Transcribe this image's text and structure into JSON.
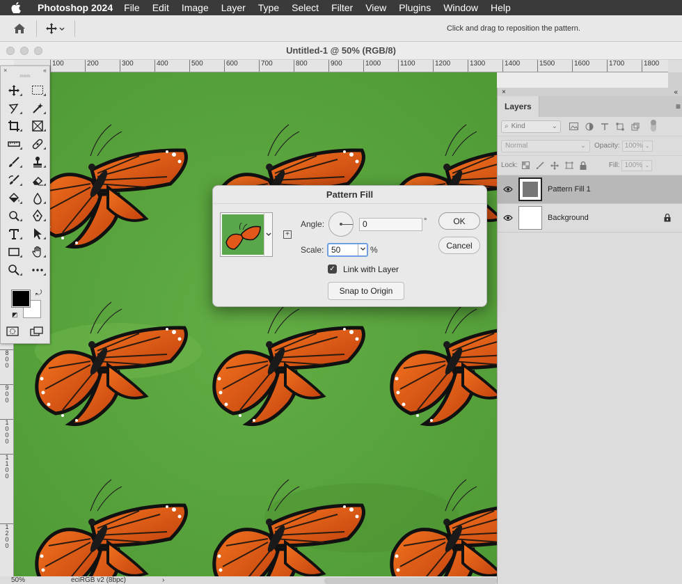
{
  "menubar": {
    "app_name": "Photoshop 2024",
    "menus": [
      "File",
      "Edit",
      "Image",
      "Layer",
      "Type",
      "Select",
      "Filter",
      "View",
      "Plugins",
      "Window",
      "Help"
    ]
  },
  "options_bar": {
    "hint": "Click and drag to reposition the pattern."
  },
  "document": {
    "title": "Untitled-1 @ 50% (RGB/8)",
    "ruler_top": [
      "100",
      "200",
      "300",
      "400",
      "500",
      "600",
      "700",
      "800",
      "900",
      "1000",
      "1100",
      "1200",
      "1300",
      "1400",
      "1500",
      "1600",
      "1700",
      "1800"
    ],
    "ruler_left": [
      "8\n0\n0",
      "9\n0\n0",
      "1\n0\n0\n0",
      "1\n1\n0\n0",
      "1\n2\n0\n0"
    ]
  },
  "status_bar": {
    "zoom": "50%",
    "profile": "eciRGB v2 (8bpc)",
    "arrow": "›"
  },
  "toolbar": {
    "collapse": "«",
    "close": "×",
    "grip": "mmm"
  },
  "layers_panel": {
    "tab_label": "Layers",
    "kind_label": "Kind",
    "blend_mode": "Normal",
    "opacity_label": "Opacity:",
    "opacity_value": "100%",
    "lock_label": "Lock:",
    "fill_label": "Fill:",
    "fill_value": "100%",
    "layers": [
      {
        "name": "Pattern Fill 1",
        "selected": true
      },
      {
        "name": "Background",
        "selected": false,
        "locked": true
      }
    ]
  },
  "dialog": {
    "title": "Pattern Fill",
    "angle_label": "Angle:",
    "angle_value": "0",
    "angle_unit": "°",
    "scale_label": "Scale:",
    "scale_value": "50",
    "scale_unit": "%",
    "link_label": "Link with Layer",
    "link_checked": true,
    "snap_label": "Snap to Origin",
    "ok_label": "OK",
    "cancel_label": "Cancel"
  },
  "colors": {
    "foreground": "#000000",
    "background": "#ffffff",
    "canvas_green": "#58a33c",
    "butterfly_orange": "#e2581a"
  }
}
